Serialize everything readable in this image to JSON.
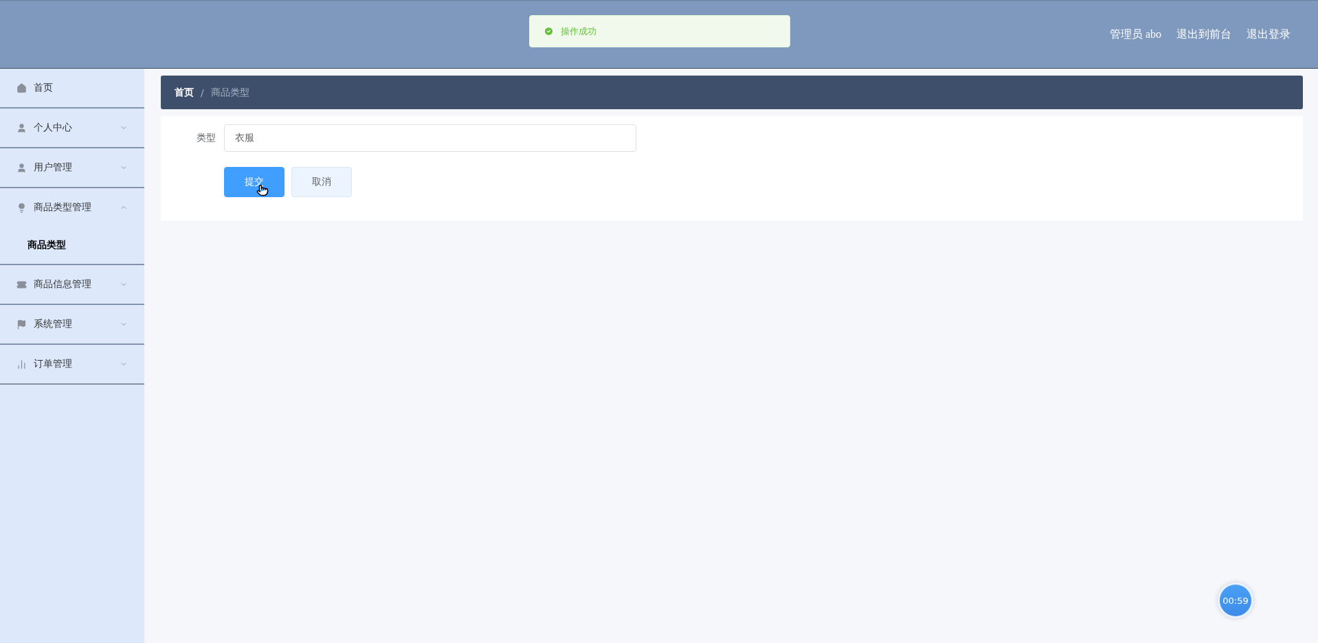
{
  "toast": {
    "message": "操作成功"
  },
  "header": {
    "links": [
      "管理员 abo",
      "退出到前台",
      "退出登录"
    ]
  },
  "sidebar": {
    "items": [
      {
        "label": "首页"
      },
      {
        "label": "个人中心",
        "expanded": false
      },
      {
        "label": "用户管理",
        "expanded": false
      },
      {
        "label": "商品类型管理",
        "expanded": true,
        "children": [
          {
            "label": "商品类型",
            "selected": true
          }
        ]
      },
      {
        "label": "商品信息管理",
        "expanded": false
      },
      {
        "label": "系统管理",
        "expanded": false
      },
      {
        "label": "订单管理",
        "expanded": false
      }
    ]
  },
  "breadcrumb": [
    "首页",
    "/",
    "商品类型"
  ],
  "form": {
    "fields": [
      {
        "label": "类型",
        "value": "衣服"
      }
    ],
    "buttons": [
      {
        "label": "提交",
        "kind": "primary"
      },
      {
        "label": "取消",
        "kind": "plain"
      }
    ]
  },
  "timer": "00:59"
}
